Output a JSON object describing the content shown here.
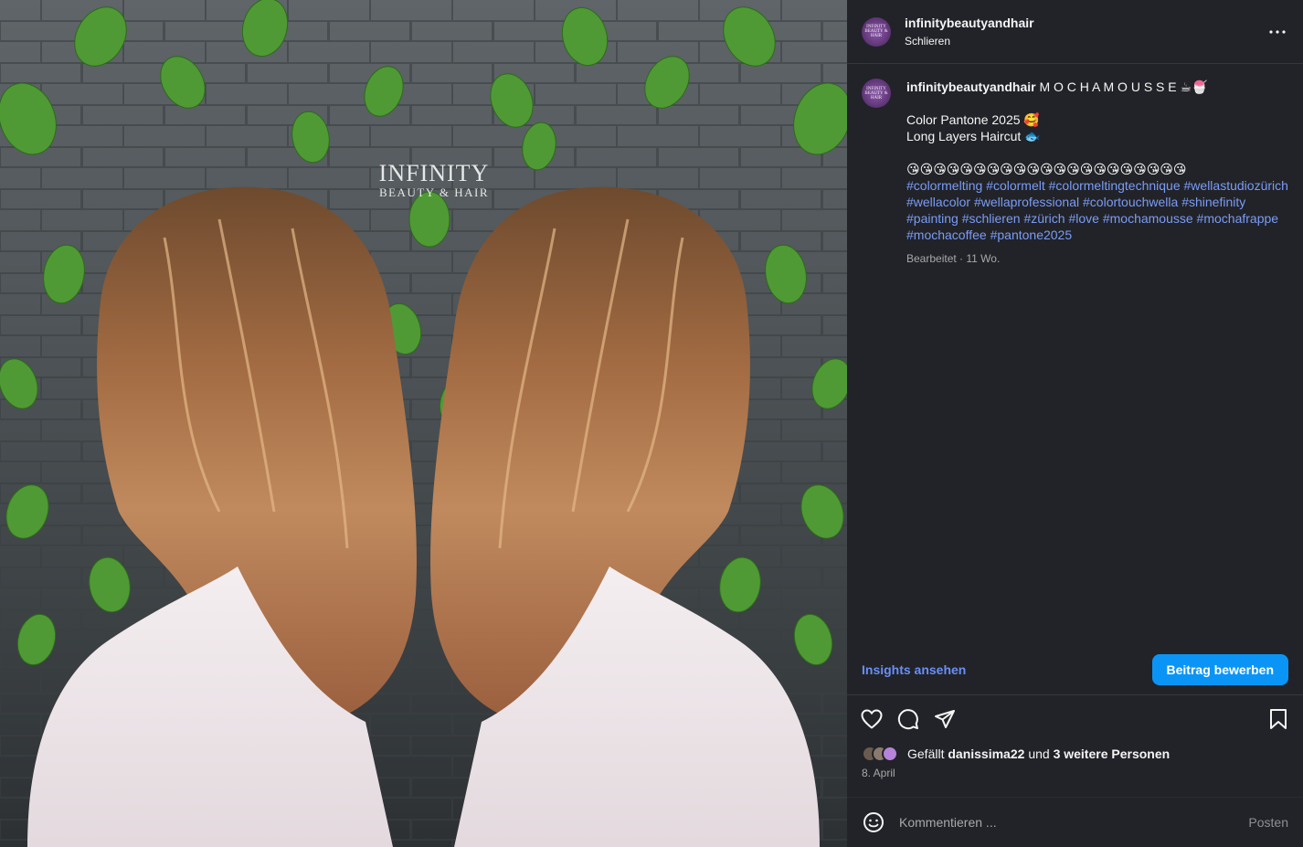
{
  "header": {
    "username": "infinitybeautyandhair",
    "location": "Schlieren",
    "avatar_text": "INFINITY BEAUTY & HAIR"
  },
  "media": {
    "watermark_line1": "INFINITY",
    "watermark_line2": "BEAUTY & HAIR"
  },
  "caption": {
    "username": "infinitybeautyandhair",
    "title": "M O C H A M O U S S E ☕🍧",
    "line1": "Color Pantone 2025 🥰",
    "line2": "Long Layers Haircut 🐟",
    "emoji_row": "😘😘😘😘😘😘😘😘😘😘😘😘😘😘😘😘😘😘😘😘😘",
    "hashtags": [
      "#colormelting",
      "#colormelt",
      "#colormeltingtechnique",
      "#wellastudiozürich",
      "#wellacolor",
      "#wellaprofessional",
      "#colortouchwella",
      "#shinefinity",
      "#painting",
      "#schlieren",
      "#zürich",
      "#love",
      "#mochamousse",
      "#mochafrappe",
      "#mochacoffee",
      "#pantone2025"
    ],
    "meta": "Bearbeitet · 11 Wo."
  },
  "actions": {
    "insights_label": "Insights ansehen",
    "promote_label": "Beitrag bewerben"
  },
  "likes": {
    "prefix": "Gefällt",
    "user": "danissima22",
    "middle": "und",
    "others": "3 weitere Personen"
  },
  "date": "8. April",
  "comment": {
    "placeholder": "Kommentieren ...",
    "post_label": "Posten"
  },
  "icons": {
    "more": "more-horizontal-icon",
    "like": "heart-icon",
    "comment": "comment-icon",
    "share": "send-icon",
    "save": "bookmark-icon",
    "emoji": "emoji-icon"
  },
  "colors": {
    "panel_bg": "#212328",
    "link_blue": "#7b9cf7",
    "button_blue": "#0a95f6"
  }
}
